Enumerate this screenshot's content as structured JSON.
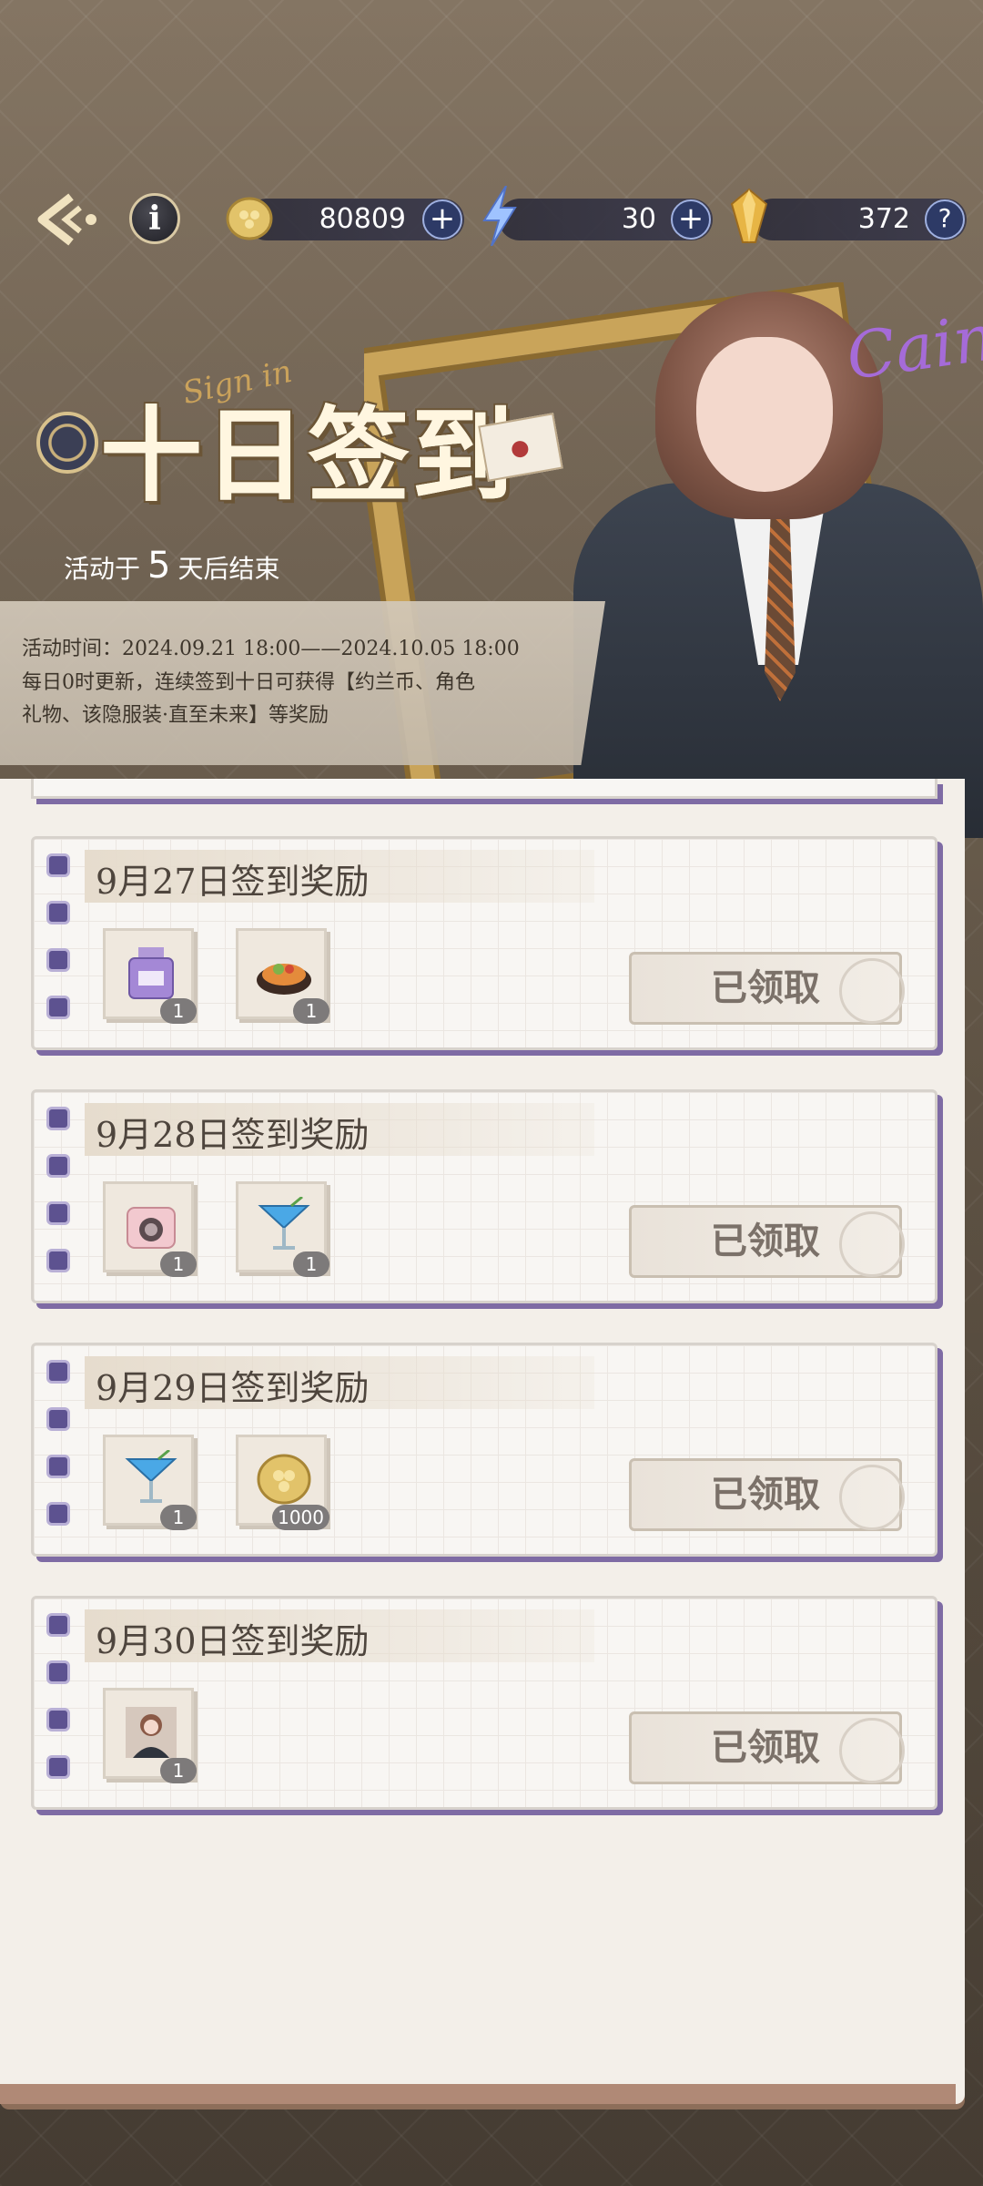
{
  "resources": {
    "coins": "80809",
    "energy": "30",
    "gems": "372"
  },
  "header": {
    "title": "十日签到",
    "sign_in_text": "Sign in",
    "countdown_prefix": "活动于",
    "countdown_days": "5",
    "countdown_suffix": "天后结束"
  },
  "art": {
    "signature": "Cain"
  },
  "info": {
    "line1": "活动时间：2024.09.21 18:00——2024.10.05 18:00",
    "line2": "每日0时更新，连续签到十日可获得【约兰币、角色",
    "line3": "礼物、该隐服装·直至未来】等奖励"
  },
  "cards": [
    {
      "day": "9月27日签到奖励",
      "rewards": [
        {
          "icon": "perfume-icon",
          "count": "1"
        },
        {
          "icon": "dish-icon",
          "count": "1"
        }
      ],
      "status": "已领取"
    },
    {
      "day": "9月28日签到奖励",
      "rewards": [
        {
          "icon": "camera-icon",
          "count": "1"
        },
        {
          "icon": "cocktail-icon",
          "count": "1"
        }
      ],
      "status": "已领取"
    },
    {
      "day": "9月29日签到奖励",
      "rewards": [
        {
          "icon": "cocktail-icon",
          "count": "1"
        },
        {
          "icon": "coin-icon",
          "count": "1000"
        }
      ],
      "status": "已领取"
    },
    {
      "day": "9月30日签到奖励",
      "rewards": [
        {
          "icon": "portrait-icon",
          "count": "1"
        }
      ],
      "status": "已领取"
    }
  ],
  "colors": {
    "accent_purple": "#5d5290",
    "coin_gold": "#d8b85a"
  }
}
